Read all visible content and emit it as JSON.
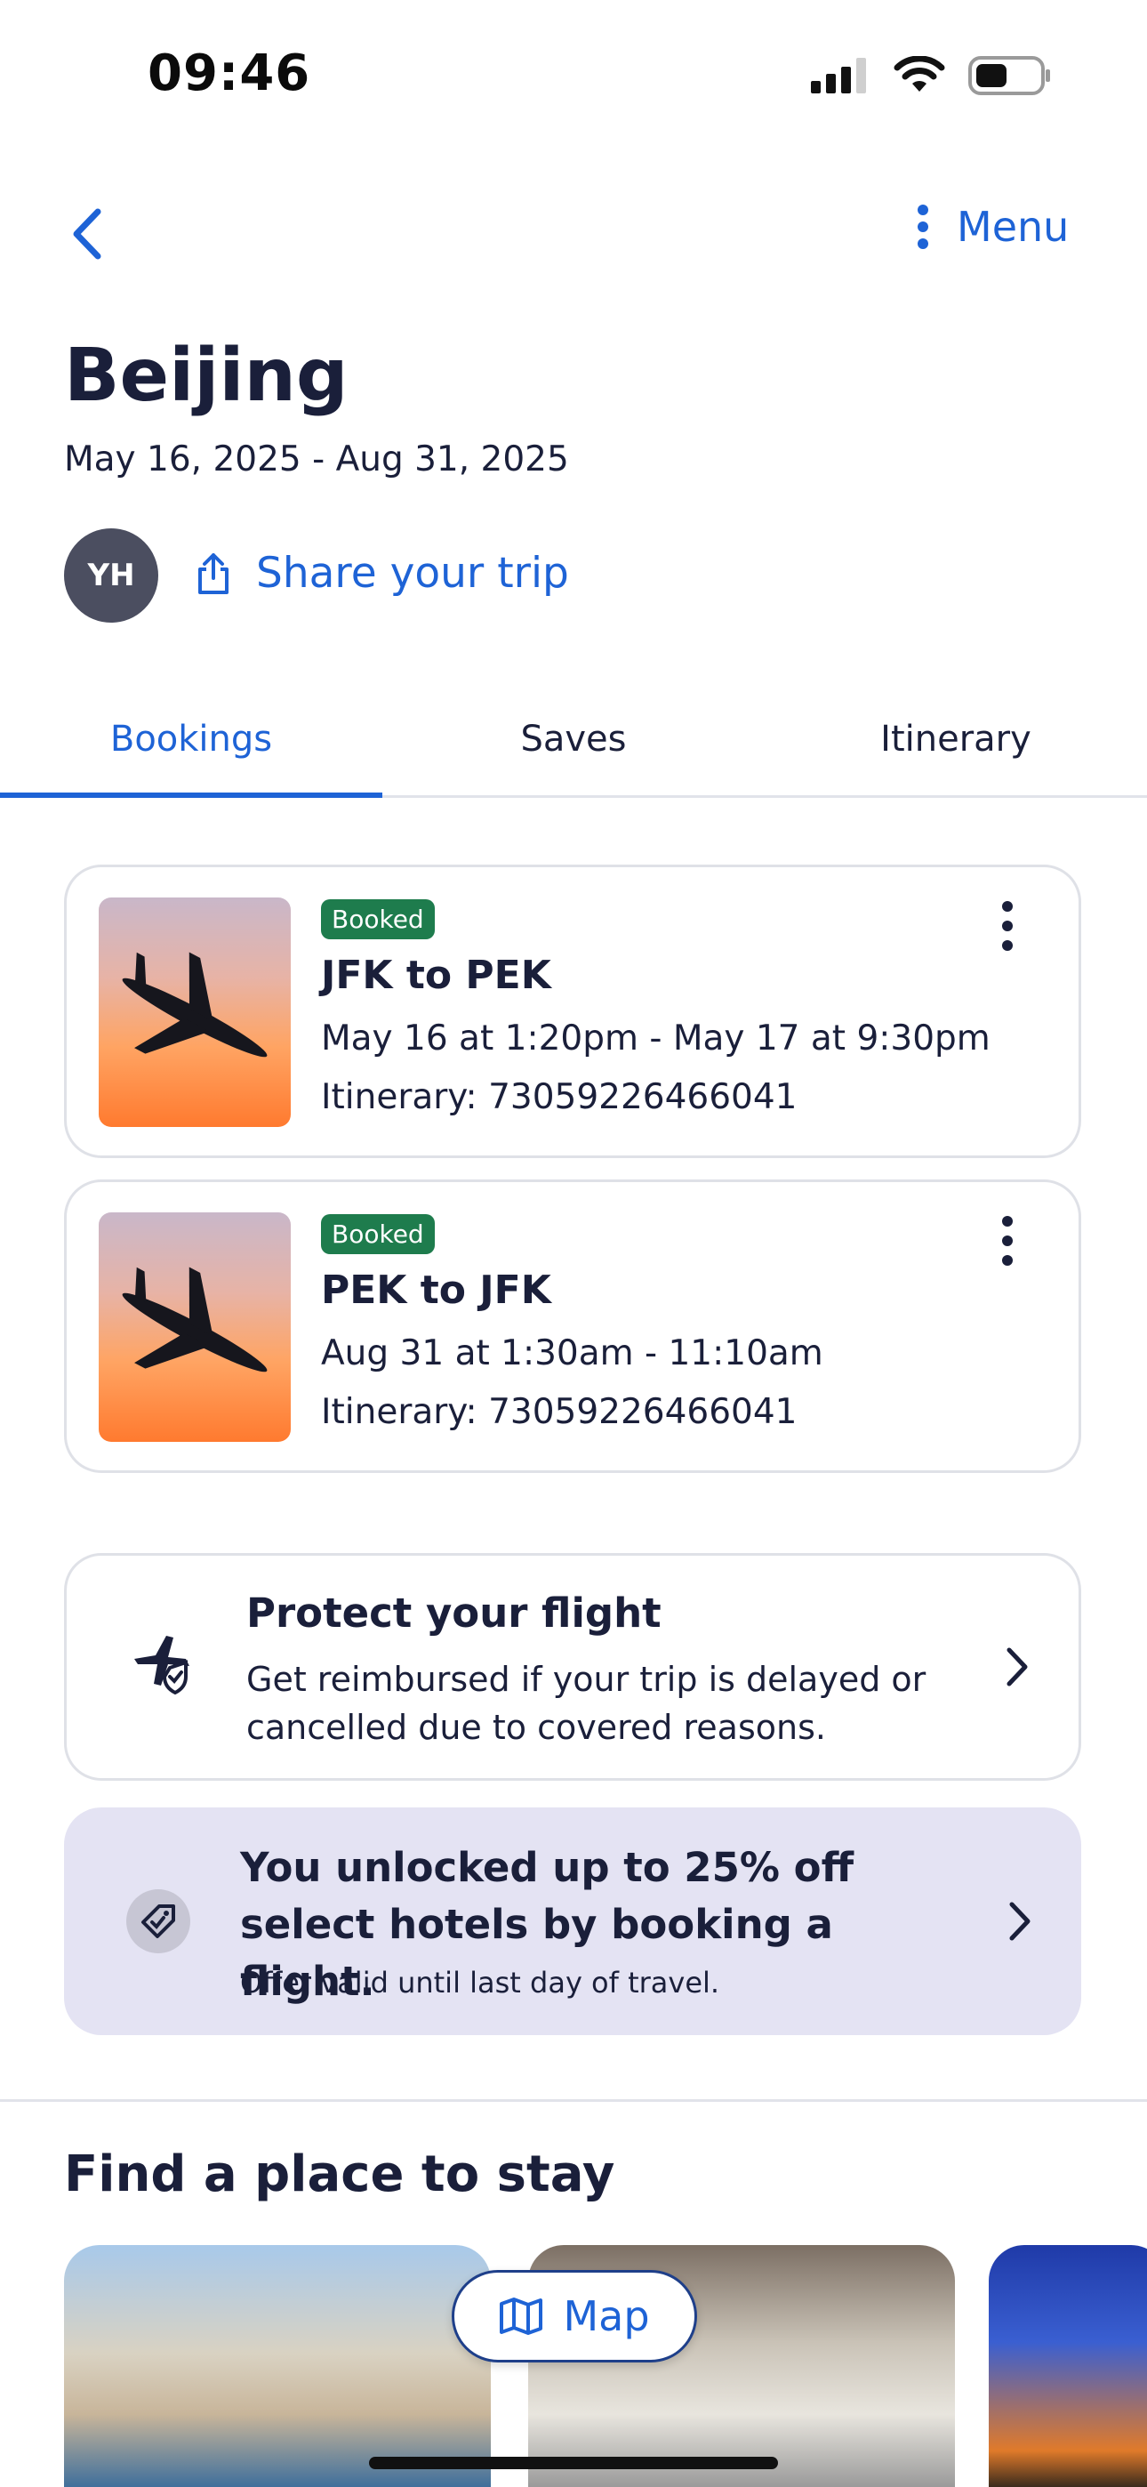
{
  "status_bar": {
    "time": "09:46"
  },
  "nav": {
    "menu_label": "Menu"
  },
  "trip": {
    "title": "Beijing",
    "dates": "May 16, 2025 - Aug 31, 2025",
    "avatar_initials": "YH",
    "share_label": "Share your trip"
  },
  "tabs": [
    {
      "label": "Bookings",
      "active": true
    },
    {
      "label": "Saves",
      "active": false
    },
    {
      "label": "Itinerary",
      "active": false
    }
  ],
  "bookings": [
    {
      "badge": "Booked",
      "route": "JFK to PEK",
      "time": "May 16 at 1:20pm - May 17 at 9:30pm",
      "itinerary": "Itinerary: 73059226466041"
    },
    {
      "badge": "Booked",
      "route": "PEK to JFK",
      "time": "Aug 31 at 1:30am - 11:10am",
      "itinerary": "Itinerary: 73059226466041"
    }
  ],
  "protect": {
    "title": "Protect your flight",
    "description": "Get reimbursed if your trip is delayed or cancelled due to covered reasons."
  },
  "promo": {
    "title": "You unlocked up to 25% off select hotels by booking a flight.",
    "note": "Offer valid until last day of travel."
  },
  "stay": {
    "heading": "Find a place to stay",
    "map_label": "Map"
  },
  "colors": {
    "accent": "#1e63d6",
    "booked_badge": "#1e7c4d",
    "promo_bg": "#e4e3f3",
    "text": "#1a1f3a"
  }
}
